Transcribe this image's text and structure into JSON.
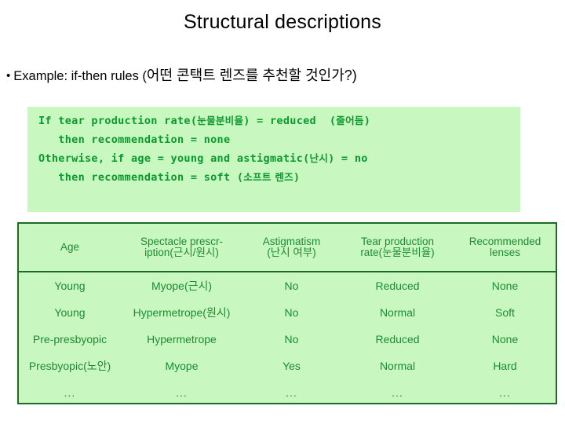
{
  "slide": {
    "title": "Structural descriptions",
    "bullet": {
      "dot": "•",
      "english": "Example: if-then rules (",
      "korean": "어떤 콘택트 렌즈를 추천할 것인가?)"
    }
  },
  "rule_block": {
    "bg_color": "#c9f7c0",
    "text_color": "#0a9a2e",
    "lines": [
      {
        "segments": [
          {
            "text": "If tear production rate(",
            "lang": "en"
          },
          {
            "text": "눈물분비율",
            "lang": "ko"
          },
          {
            "text": ") = reduced  (",
            "lang": "en"
          },
          {
            "text": "줄어듬",
            "lang": "ko"
          },
          {
            "text": ")",
            "lang": "en"
          }
        ]
      },
      {
        "segments": [
          {
            "text": "   then recommendation = none",
            "lang": "en"
          }
        ]
      },
      {
        "segments": [
          {
            "text": "Otherwise, if age = young and astigmatic(",
            "lang": "en"
          },
          {
            "text": "난시",
            "lang": "ko"
          },
          {
            "text": ") = no",
            "lang": "en"
          }
        ]
      },
      {
        "segments": [
          {
            "text": "   then recommendation = soft (",
            "lang": "en"
          },
          {
            "text": "소프트 렌즈",
            "lang": "ko"
          },
          {
            "text": ")",
            "lang": "en"
          }
        ]
      }
    ]
  },
  "table": {
    "border_color": "#1d6b26",
    "bg_color": "#c9f7c0",
    "text_color": "#1d8b33",
    "headers": [
      {
        "line1": "Age",
        "line2": ""
      },
      {
        "line1": "Spectacle prescr-",
        "line2": "iption(근시/원시)"
      },
      {
        "line1": "Astigmatism",
        "line2": "(난시 여부)"
      },
      {
        "line1": "Tear production",
        "line2": "rate(눈물분비율)"
      },
      {
        "line1": "Recommended",
        "line2": "lenses"
      }
    ],
    "rows": [
      {
        "age": "Young",
        "spectacle": "Myope(근시)",
        "astigmatism": "No",
        "tear_rate": "Reduced",
        "lenses": "None"
      },
      {
        "age": "Young",
        "spectacle": "Hypermetrope(원시)",
        "astigmatism": "No",
        "tear_rate": "Normal",
        "lenses": "Soft"
      },
      {
        "age": "Pre-presbyopic",
        "spectacle": "Hypermetrope",
        "astigmatism": "No",
        "tear_rate": "Reduced",
        "lenses": "None"
      },
      {
        "age": "Presbyopic(노안)",
        "spectacle": "Myope",
        "astigmatism": "Yes",
        "tear_rate": "Normal",
        "lenses": "Hard"
      },
      {
        "age": "...",
        "spectacle": "...",
        "astigmatism": "...",
        "tear_rate": "...",
        "lenses": "..."
      }
    ]
  }
}
